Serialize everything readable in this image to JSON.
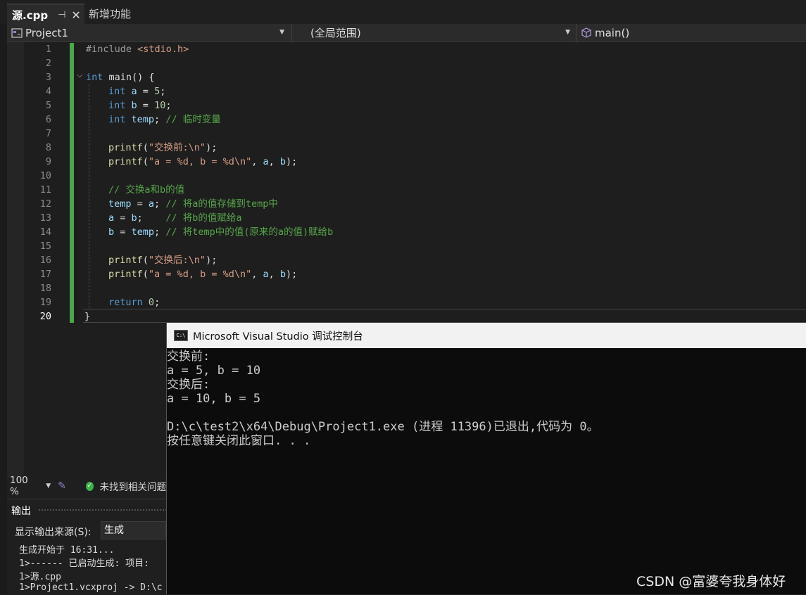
{
  "tabs": [
    {
      "label": "源.cpp",
      "pin": "⊣",
      "close": "✕"
    },
    {
      "label": "新增功能"
    }
  ],
  "navbar": {
    "project": "Project1",
    "scope": "(全局范围)",
    "function": "main()"
  },
  "editor": {
    "line_numbers": [
      "1",
      "2",
      "3",
      "4",
      "5",
      "6",
      "7",
      "8",
      "9",
      "10",
      "11",
      "12",
      "13",
      "14",
      "15",
      "16",
      "17",
      "18",
      "19",
      "20"
    ]
  },
  "status": {
    "zoom": "100 %",
    "issues": "未找到相关问题"
  },
  "output": {
    "title": "输出",
    "source_label": "显示输出来源(S):",
    "source_value": "生成",
    "lines": [
      "生成开始于 16:31...",
      "1>------ 已启动生成: 项目:",
      "1>源.cpp",
      "1>Project1.vcxproj -> D:\\c"
    ]
  },
  "console": {
    "title": "Microsoft Visual Studio 调试控制台",
    "icon_text": "C:\\",
    "lines": [
      "交换前:",
      "a = 5, b = 10",
      "交换后:",
      "a = 10, b = 5",
      "",
      "D:\\c\\test2\\x64\\Debug\\Project1.exe (进程 11396)已退出,代码为 0。",
      "按任意键关闭此窗口. . ."
    ]
  },
  "watermark": "CSDN @富婆夸我身体好",
  "colors": {
    "keyword": "#569cd6",
    "comment": "#57a64a",
    "string": "#d69d85",
    "number": "#b5cea8",
    "change_bar": "#4aa84a"
  }
}
